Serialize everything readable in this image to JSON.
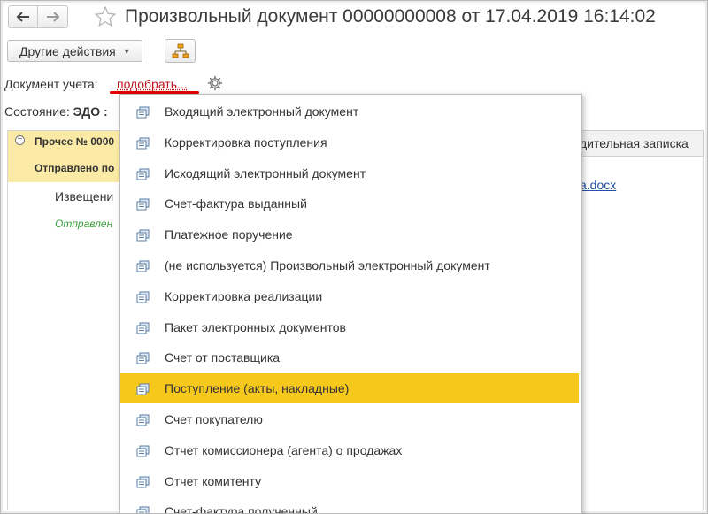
{
  "window": {
    "title": "Произвольный документ 00000000008 от 17.04.2019 16:14:02"
  },
  "toolbar": {
    "other_actions_label": "Другие действия"
  },
  "form": {
    "doc_label": "Документ учета:",
    "pick_link": "подобрать...",
    "state_label": "Состояние:",
    "state_value": "ЭДО :"
  },
  "background_table": {
    "row1_text": "Прочее № 0000",
    "row2_text": "Отправлено по",
    "row3_text": "Извещени",
    "row4_text": "Отправлен",
    "tab_text": "дительная записка",
    "file_link": "a.docx"
  },
  "dropdown": {
    "items": [
      {
        "label": "Входящий электронный документ",
        "selected": false
      },
      {
        "label": "Корректировка поступления",
        "selected": false
      },
      {
        "label": "Исходящий электронный документ",
        "selected": false
      },
      {
        "label": "Счет-фактура выданный",
        "selected": false
      },
      {
        "label": "Платежное поручение",
        "selected": false
      },
      {
        "label": "(не используется) Произвольный электронный документ",
        "selected": false
      },
      {
        "label": "Корректировка реализации",
        "selected": false
      },
      {
        "label": "Пакет электронных документов",
        "selected": false
      },
      {
        "label": "Счет от поставщика",
        "selected": false
      },
      {
        "label": "Поступление (акты, накладные)",
        "selected": true
      },
      {
        "label": "Счет покупателю",
        "selected": false
      },
      {
        "label": "Отчет комиссионера (агента) о продажах",
        "selected": false
      },
      {
        "label": "Отчет комитенту",
        "selected": false
      },
      {
        "label": "Счет-фактура полученный",
        "selected": false
      }
    ]
  },
  "colors": {
    "selected_item": "#f7c81c",
    "link_red": "#c0141b",
    "highlight_row": "#fbeaa6",
    "underline_mark": "#e60000"
  }
}
